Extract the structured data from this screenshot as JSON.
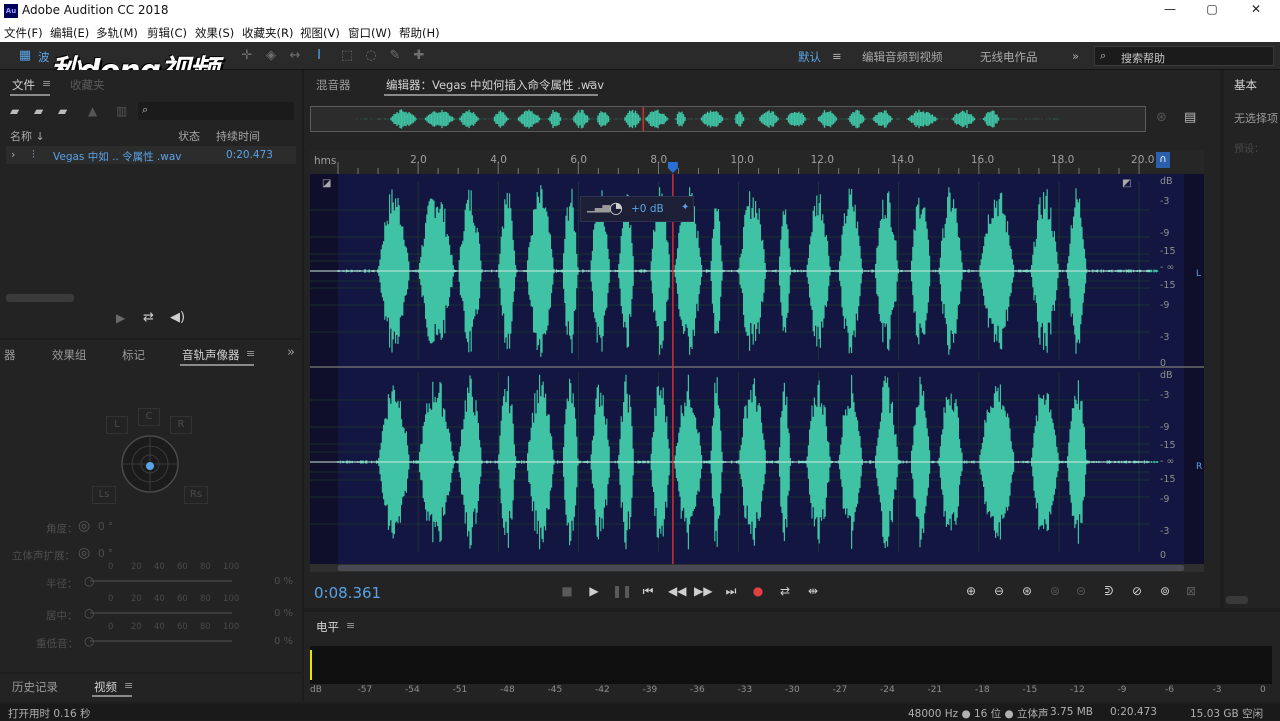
{
  "window": {
    "title": "Adobe Audition CC 2018",
    "app_icon": "Au"
  },
  "menu": [
    "文件(F)",
    "编辑(E)",
    "多轨(M)",
    "剪辑(C)",
    "效果(S)",
    "收藏夹(R)",
    "视图(V)",
    "窗口(W)",
    "帮助(H)"
  ],
  "toolbar": {
    "waveform_label": "波",
    "workspaces": [
      "默认",
      "编辑音频到视频",
      "无线电作品"
    ],
    "search_placeholder": "搜索帮助"
  },
  "watermark": "秒dong视频",
  "files_panel": {
    "tabs": [
      "文件",
      "收藏夹"
    ],
    "columns": [
      "名称",
      "状态",
      "持续时间"
    ],
    "rows": [
      {
        "name": "Vegas 中如 .. 令属性 .wav",
        "duration": "0:20.473"
      }
    ]
  },
  "mid_panel": {
    "tabs": [
      "器",
      "效果组",
      "标记",
      "音轨声像器"
    ],
    "panner": {
      "c": "C",
      "l": "L",
      "r": "R",
      "ls": "Ls",
      "rs": "Rs"
    },
    "rows": [
      {
        "label": "角度：",
        "value": "0 °"
      },
      {
        "label": "立体声扩展：",
        "value": "0 °"
      }
    ],
    "sliders": [
      {
        "label": "半径：",
        "value": "0 %"
      },
      {
        "label": "居中：",
        "value": "0 %"
      },
      {
        "label": "重低音：",
        "value": "0 %"
      }
    ],
    "slider_ticks": [
      "0",
      "20",
      "40",
      "60",
      "80",
      "100"
    ]
  },
  "bottom_left": {
    "tabs": [
      "历史记录",
      "视频"
    ]
  },
  "editor": {
    "tabs": [
      "混音器",
      "编辑器：Vegas 中如何插入命令属性 .wav"
    ],
    "ruler_unit": "hms",
    "ruler_labels": [
      "2.0",
      "4.0",
      "6.0",
      "8.0",
      "10.0",
      "12.0",
      "14.0",
      "16.0",
      "18.0",
      "20.0"
    ],
    "hud_gain": "+0 dB",
    "db_scale_top": [
      "dB",
      "-3",
      "-9",
      "-15",
      "- ∞",
      "-15",
      "-9",
      "-3"
    ],
    "db_scale_bottom": [
      "0",
      "dB",
      "-3",
      "-9",
      "-15",
      "- ∞",
      "-15",
      "-9",
      "-3",
      "0"
    ],
    "channel_l": "L",
    "channel_r": "R",
    "current_time": "0:08.361",
    "duration_seconds": 20.473,
    "playhead_seconds": 8.361,
    "wave_color": "#3fc3a4",
    "accent": "#5aa3e6"
  },
  "right_panel": {
    "tabs": [
      "基本"
    ],
    "text": "无选择项",
    "sub": "预设："
  },
  "levels": {
    "title": "电平",
    "scale": [
      "dB",
      "-57",
      "-54",
      "-51",
      "-48",
      "-45",
      "-42",
      "-39",
      "-36",
      "-33",
      "-30",
      "-27",
      "-24",
      "-21",
      "-18",
      "-15",
      "-12",
      "-9",
      "-6",
      "-3",
      "0"
    ]
  },
  "status": {
    "left": "打开用时 0.16 秒",
    "format": "48000 Hz ● 16 位 ● 立体声",
    "size": "3.75 MB",
    "duration": "0:20.473",
    "free": "15.03 GB 空闲"
  }
}
